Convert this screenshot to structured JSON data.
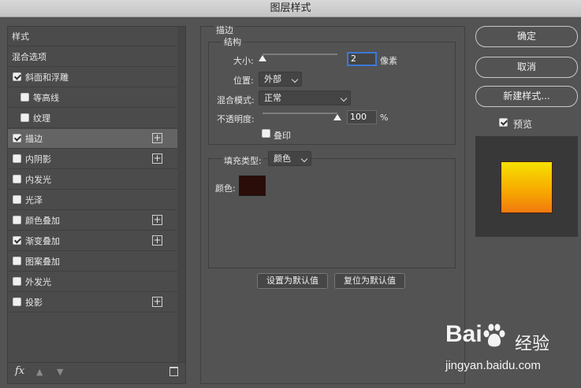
{
  "window": {
    "title": "图层样式"
  },
  "left_panel": {
    "header": "样式",
    "items": [
      {
        "label": "混合选项",
        "has_checkbox": false,
        "checked": false,
        "has_plus": false,
        "indent": 0,
        "selected": false
      },
      {
        "label": "斜面和浮雕",
        "has_checkbox": true,
        "checked": true,
        "has_plus": false,
        "indent": 0,
        "selected": false
      },
      {
        "label": "等高线",
        "has_checkbox": true,
        "checked": false,
        "has_plus": false,
        "indent": 1,
        "selected": false
      },
      {
        "label": "纹理",
        "has_checkbox": true,
        "checked": false,
        "has_plus": false,
        "indent": 1,
        "selected": false
      },
      {
        "label": "描边",
        "has_checkbox": true,
        "checked": true,
        "has_plus": true,
        "indent": 0,
        "selected": true
      },
      {
        "label": "内阴影",
        "has_checkbox": true,
        "checked": false,
        "has_plus": true,
        "indent": 0,
        "selected": false
      },
      {
        "label": "内发光",
        "has_checkbox": true,
        "checked": false,
        "has_plus": false,
        "indent": 0,
        "selected": false
      },
      {
        "label": "光泽",
        "has_checkbox": true,
        "checked": false,
        "has_plus": false,
        "indent": 0,
        "selected": false
      },
      {
        "label": "颜色叠加",
        "has_checkbox": true,
        "checked": false,
        "has_plus": true,
        "indent": 0,
        "selected": false
      },
      {
        "label": "渐变叠加",
        "has_checkbox": true,
        "checked": true,
        "has_plus": true,
        "indent": 0,
        "selected": false
      },
      {
        "label": "图案叠加",
        "has_checkbox": true,
        "checked": false,
        "has_plus": false,
        "indent": 0,
        "selected": false
      },
      {
        "label": "外发光",
        "has_checkbox": true,
        "checked": false,
        "has_plus": false,
        "indent": 0,
        "selected": false
      },
      {
        "label": "投影",
        "has_checkbox": true,
        "checked": false,
        "has_plus": true,
        "indent": 0,
        "selected": false
      }
    ],
    "footer": {
      "fx_label": "fx",
      "fx_icon": "fx-icon",
      "up_icon": "arrow-up-icon",
      "down_icon": "arrow-down-icon",
      "trash_icon": "trash-icon"
    }
  },
  "stroke_panel": {
    "title": "描边",
    "structure": {
      "title": "结构",
      "size_label": "大小:",
      "size_value": "2",
      "size_unit": "像素",
      "size_slider_level": 0.0,
      "position_label": "位置:",
      "position_value": "外部",
      "blend_label": "混合模式:",
      "blend_value": "正常",
      "opacity_label": "不透明度:",
      "opacity_value": "100",
      "opacity_unit": "%",
      "opacity_slider_level": 1.0,
      "overprint_label": "叠印",
      "overprint_checked": false
    },
    "fill": {
      "type_label": "填充类型:",
      "type_value": "颜色",
      "color_label": "颜色:",
      "color_hex": "#2a0c08"
    },
    "make_default": "设置为默认值",
    "reset_default": "复位为默认值"
  },
  "right_panel": {
    "ok": "确定",
    "cancel": "取消",
    "new_style": "新建样式...",
    "preview_label": "预览",
    "preview_checked": true,
    "preview_gradient": [
      "#f6e100",
      "#f7a600",
      "#f07a10"
    ]
  },
  "watermark": {
    "logo_text": "Bai",
    "logo_suffix": "经验",
    "url": "jingyan.baidu.com"
  }
}
